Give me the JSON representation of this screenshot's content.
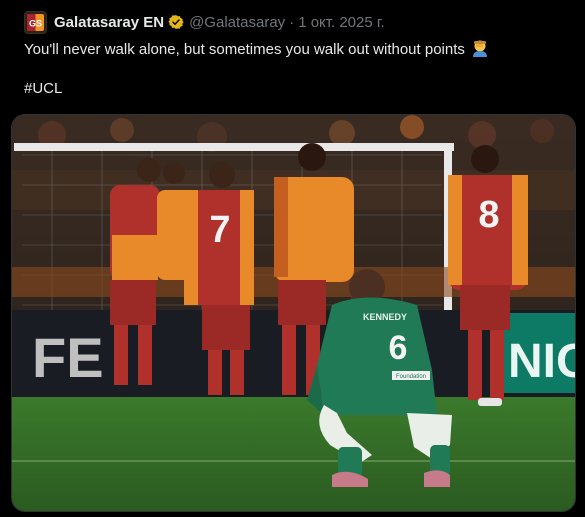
{
  "tweet": {
    "author_name": "Galatasaray EN",
    "handle": "@Galatasaray",
    "separator": "·",
    "date": "1 окт. 2025 г.",
    "text_line1": "You'll never walk alone, but sometimes you walk out without points",
    "hashtag": "#UCL"
  },
  "icons": {
    "avatar": "galatasaray-logo-icon",
    "verified": "verified-badge-icon",
    "emoji": "facepalm-emoji-icon"
  },
  "colors": {
    "background": "#000000",
    "text": "#e7e9ea",
    "muted": "#71767b",
    "verified_gold": "#e2b719",
    "galatasaray_red": "#a8232b",
    "galatasaray_orange": "#f39325",
    "opponent_green": "#1f7a55",
    "pitch_green": "#2f6a26"
  },
  "photo": {
    "ad_board_left": "FE",
    "ad_board_right": "NIG",
    "player_numbers": [
      "7",
      "8",
      "6"
    ],
    "opponent_shirt_name": "KENNEDY",
    "sponsor_text": "Foundation"
  }
}
